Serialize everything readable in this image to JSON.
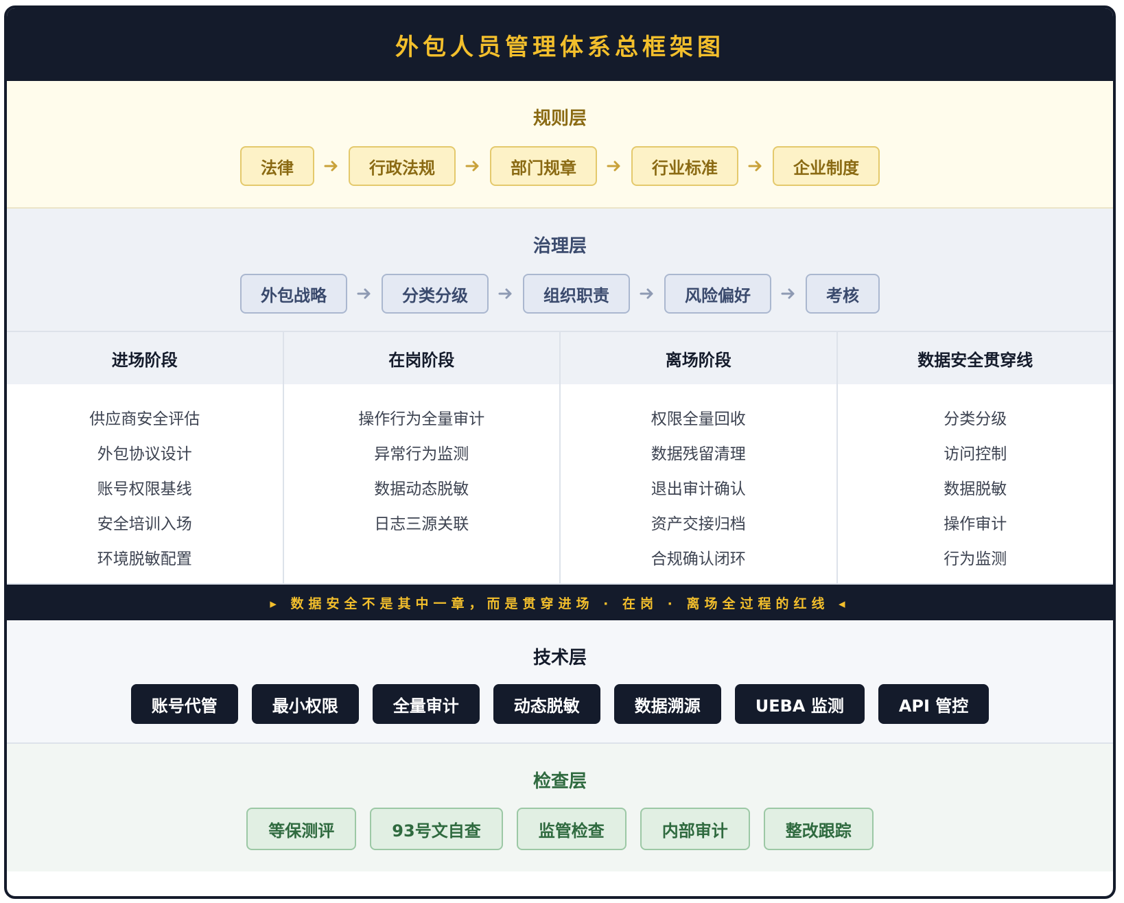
{
  "title": "外包人员管理体系总框架图",
  "rule_layer": {
    "title": "规则层",
    "items": [
      "法律",
      "行政法规",
      "部门规章",
      "行业标准",
      "企业制度"
    ],
    "arrow_color": "#c9a23a"
  },
  "governance_layer": {
    "title": "治理层",
    "items": [
      "外包战略",
      "分类分级",
      "组织职责",
      "风险偏好",
      "考核"
    ],
    "arrow_color": "#8e9ab3"
  },
  "stages": [
    {
      "title": "进场阶段",
      "items": [
        "供应商安全评估",
        "外包协议设计",
        "账号权限基线",
        "安全培训入场",
        "环境脱敏配置"
      ]
    },
    {
      "title": "在岗阶段",
      "items": [
        "操作行为全量审计",
        "异常行为监测",
        "数据动态脱敏",
        "日志三源关联"
      ]
    },
    {
      "title": "离场阶段",
      "items": [
        "权限全量回收",
        "数据残留清理",
        "退出审计确认",
        "资产交接归档",
        "合规确认闭环"
      ]
    },
    {
      "title": "数据安全贯穿线",
      "items": [
        "分类分级",
        "访问控制",
        "数据脱敏",
        "操作审计",
        "行为监测"
      ]
    }
  ],
  "banner": "▸ 数据安全不是其中一章，而是贯穿进场 · 在岗 · 离场全过程的红线 ◂",
  "tech_layer": {
    "title": "技术层",
    "items": [
      "账号代管",
      "最小权限",
      "全量审计",
      "动态脱敏",
      "数据溯源",
      "UEBA 监测",
      "API 管控"
    ]
  },
  "check_layer": {
    "title": "检查层",
    "items": [
      "等保测评",
      "93号文自查",
      "监管检查",
      "内部审计",
      "整改跟踪"
    ]
  },
  "colors": {
    "dark": "#141b2b",
    "gold": "#f3bf2c",
    "rule_text": "#8a6a13",
    "governance_text": "#3a4a6d",
    "check_text": "#2f6a3f"
  }
}
